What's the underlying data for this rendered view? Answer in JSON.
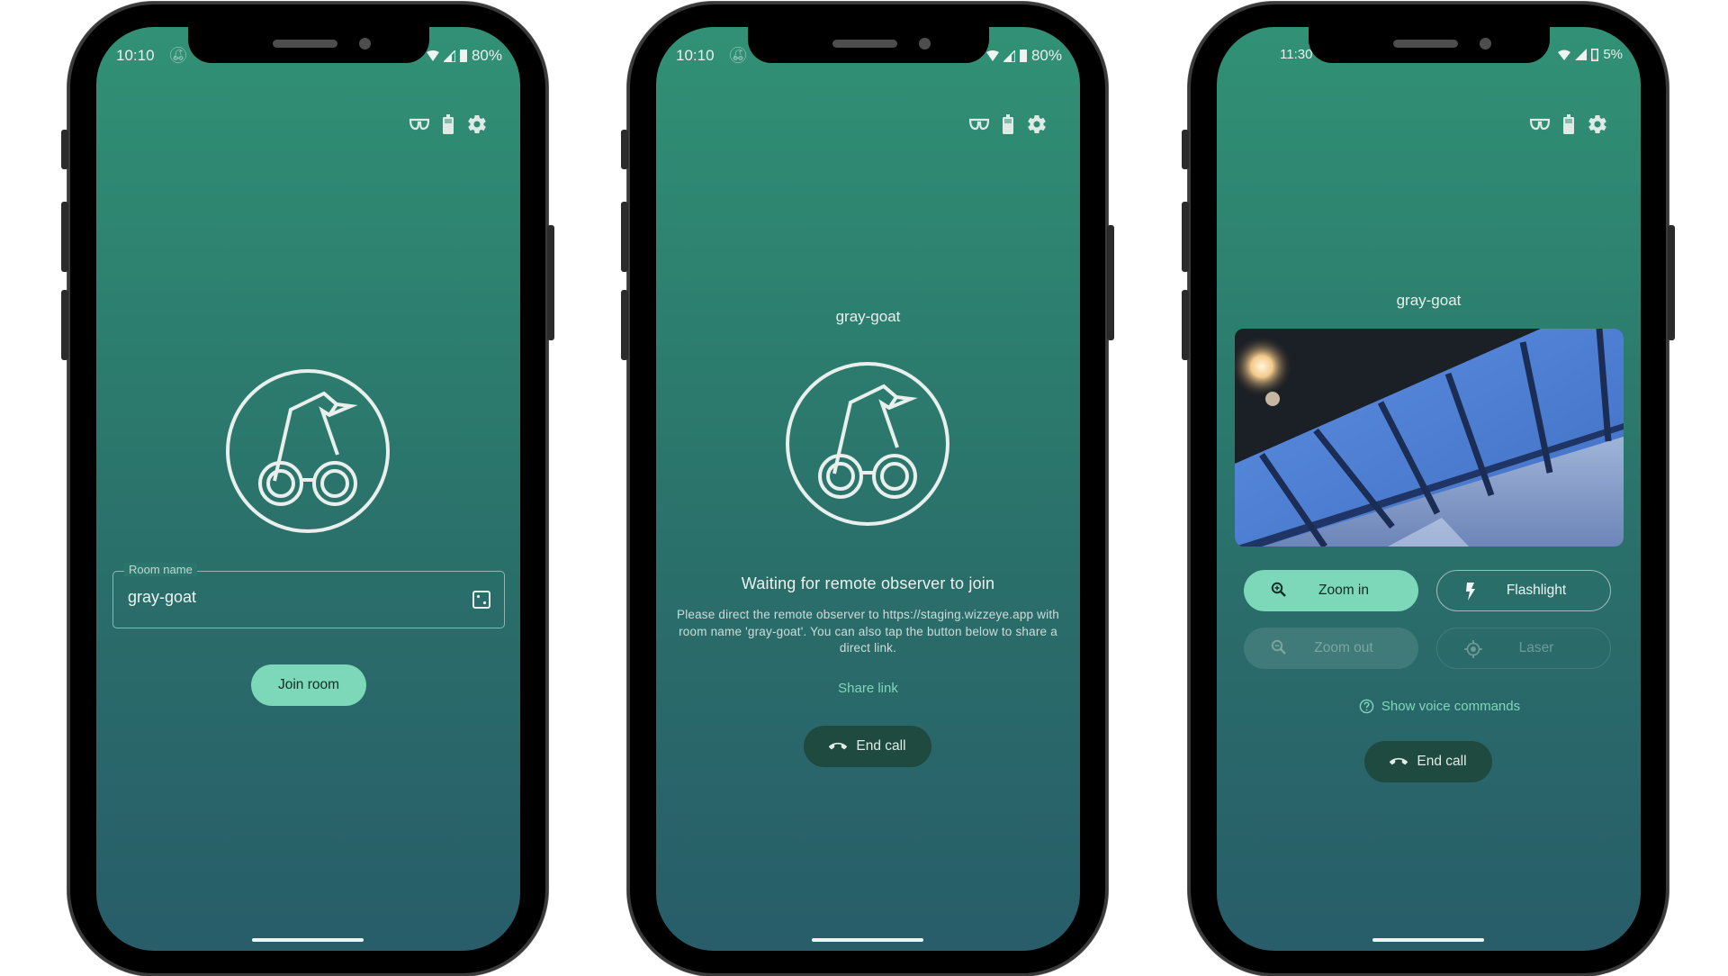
{
  "colors": {
    "accent": "#7dd8b9",
    "end_call_bg": "#1f4a40",
    "gradient_top": "#319175",
    "gradient_bottom": "#285d69"
  },
  "phones": [
    {
      "status": {
        "time": "10:10",
        "battery": "80%",
        "app_icon": "wizzeye-logo-icon"
      },
      "top_icons": [
        "glasses-icon",
        "battery-icon",
        "settings-icon"
      ],
      "room_field": {
        "label": "Room name",
        "value": "gray-goat",
        "action_icon": "dice-icon"
      },
      "join_button": "Join room"
    },
    {
      "status": {
        "time": "10:10",
        "battery": "80%",
        "app_icon": "wizzeye-logo-icon"
      },
      "top_icons": [
        "glasses-icon",
        "battery-icon",
        "settings-icon"
      ],
      "room_name": "gray-goat",
      "waiting_title": "Waiting for remote observer to join",
      "waiting_desc": "Please direct the remote observer to https://staging.wizzeye.app with room name 'gray-goat'. You can also tap the button below to share a direct link.",
      "share_link": "Share link",
      "end_call": "End call"
    },
    {
      "status": {
        "time": "11:30",
        "battery": "5%"
      },
      "top_icons": [
        "glasses-icon",
        "battery-icon",
        "settings-icon"
      ],
      "room_name": "gray-goat",
      "video_description": "Camera feed of a ceiling with skylight panels",
      "controls": [
        {
          "label": "Zoom in",
          "icon": "zoom-in-icon",
          "state": "active"
        },
        {
          "label": "Flashlight",
          "icon": "flash-icon",
          "state": "enabled"
        },
        {
          "label": "Zoom out",
          "icon": "zoom-out-icon",
          "state": "disabled"
        },
        {
          "label": "Laser",
          "icon": "laser-target-icon",
          "state": "disabled"
        }
      ],
      "voice_commands": "Show voice commands",
      "end_call": "End call"
    }
  ]
}
